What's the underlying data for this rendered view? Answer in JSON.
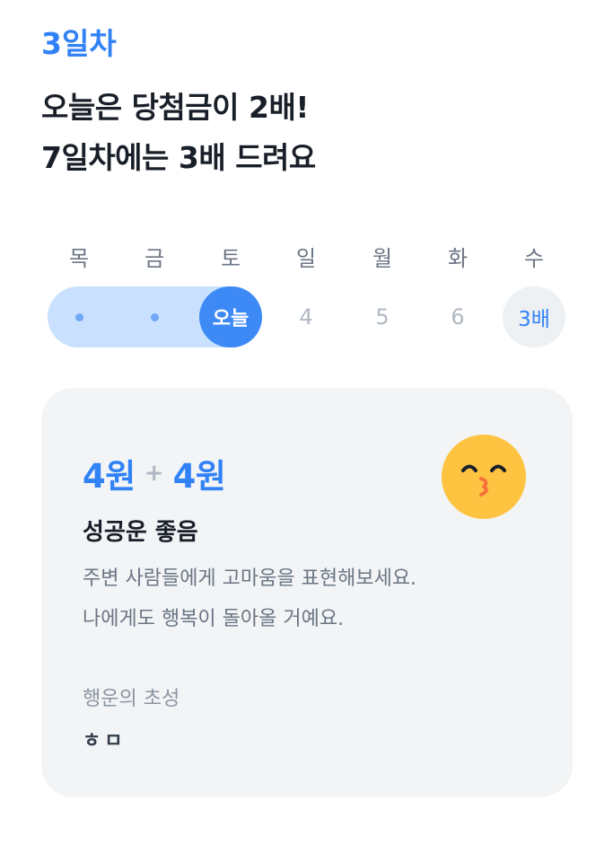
{
  "header": {
    "day_label": "3일차",
    "headline_line1": "오늘은 당첨금이 2배!",
    "headline_line2": "7일차에는 3배 드려요"
  },
  "week": {
    "weekdays": [
      "목",
      "금",
      "토",
      "일",
      "월",
      "화",
      "수"
    ],
    "today_label": "오늘",
    "future_days": [
      "4",
      "5",
      "6"
    ],
    "bonus_label": "3배"
  },
  "card": {
    "amount_base": "4원",
    "plus_sign": "+",
    "amount_bonus": "4원",
    "emoji": "kissing-face-icon",
    "fortune_title": "성공운 좋음",
    "fortune_desc_line1": "주변 사람들에게 고마움을 표현해보세요.",
    "fortune_desc_line2": "나에게도 행복이 돌아올 거예요.",
    "initials_label": "행운의 초성",
    "initials": "ㅎㅁ"
  },
  "colors": {
    "accent": "#3182f6",
    "track": "#c9e1ff",
    "card_bg": "#f2f4f6",
    "emoji_face": "#ffc342"
  }
}
